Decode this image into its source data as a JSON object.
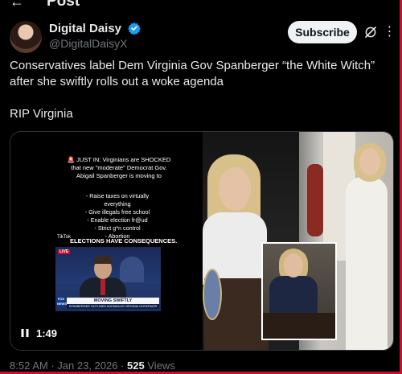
{
  "header": {
    "title": "Post",
    "display_name": "Digital Daisy",
    "handle": "@DigitalDaisyX",
    "subscribe_label": "Subscribe"
  },
  "post": {
    "line1": "Conservatives label Dem Virginia Gov Spanberger “the White Witch” after she swiftly rolls out a woke agenda",
    "line2": "RIP Virginia"
  },
  "video": {
    "duration": "1:49",
    "overlay_headline": [
      "🚨 JUST IN: Virginians are SHOCKED",
      "that new \"moderate\" Democrat Gov.",
      "Abigail Spanberger is moving to"
    ],
    "overlay_list": [
      "- Raise taxes on virtually everything",
      "- Give illegals free school",
      "- Enable election fr@ud",
      "- Strict g*n control",
      "- Abortion"
    ],
    "overlay_footer": "ELECTIONS HAVE CONSEQUENCES.",
    "tiktok_mark": "TikTok",
    "tv_badge": "LIVE",
    "tv_network": "FOX NEWS",
    "tv_chyron": "MOVING SWIFTLY",
    "tv_chyron_sub": "SPANBERGER OUTLINES AGENDA AS VIRGINIA GOVERNOR"
  },
  "meta": {
    "time": "8:52 AM",
    "date": "Jan 23, 2026",
    "views": "525",
    "views_label": "Views"
  },
  "colors": {
    "background": "#000000",
    "text": "#e7e9ea",
    "muted": "#71767b",
    "verified": "#1d9bf0",
    "frame": "#c8102e"
  }
}
